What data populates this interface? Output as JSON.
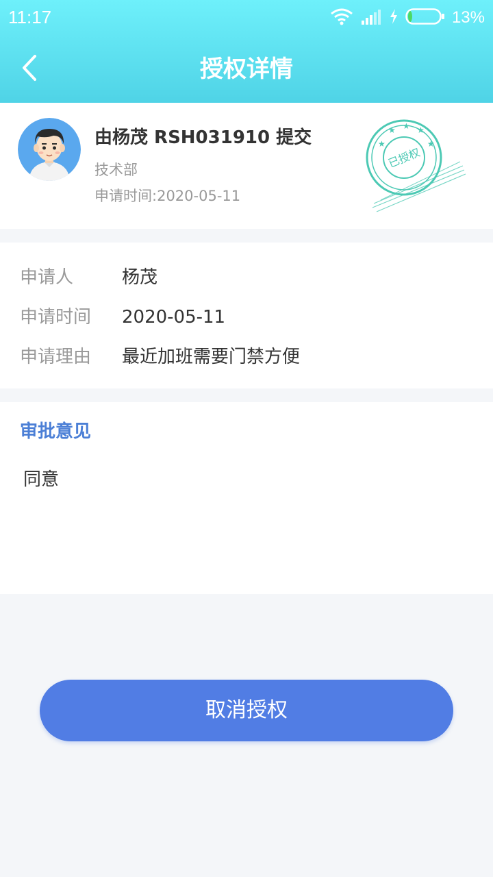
{
  "status_bar": {
    "time": "11:17",
    "battery_percent": "13%",
    "battery_level": 0.13
  },
  "nav": {
    "title": "授权详情"
  },
  "summary": {
    "submitter_line": "由杨茂 RSH031910 提交",
    "department": "技术部",
    "apply_time_label": "申请时间:",
    "apply_time_value": "2020-05-11",
    "stamp_text": "已授权",
    "stamp_color": "#4cc9b4"
  },
  "details": [
    {
      "label": "申请人",
      "value": "杨茂"
    },
    {
      "label": "申请时间",
      "value": "2020-05-11"
    },
    {
      "label": "申请理由",
      "value": "最近加班需要门禁方便"
    }
  ],
  "opinion": {
    "title": "审批意见",
    "text": "同意"
  },
  "actions": {
    "cancel_label": "取消授权"
  },
  "colors": {
    "header_gradient_top": "#6ef0fb",
    "header_gradient_bottom": "#4fd3e6",
    "accent_blue": "#4b7fd6",
    "button_blue": "#517de4"
  }
}
